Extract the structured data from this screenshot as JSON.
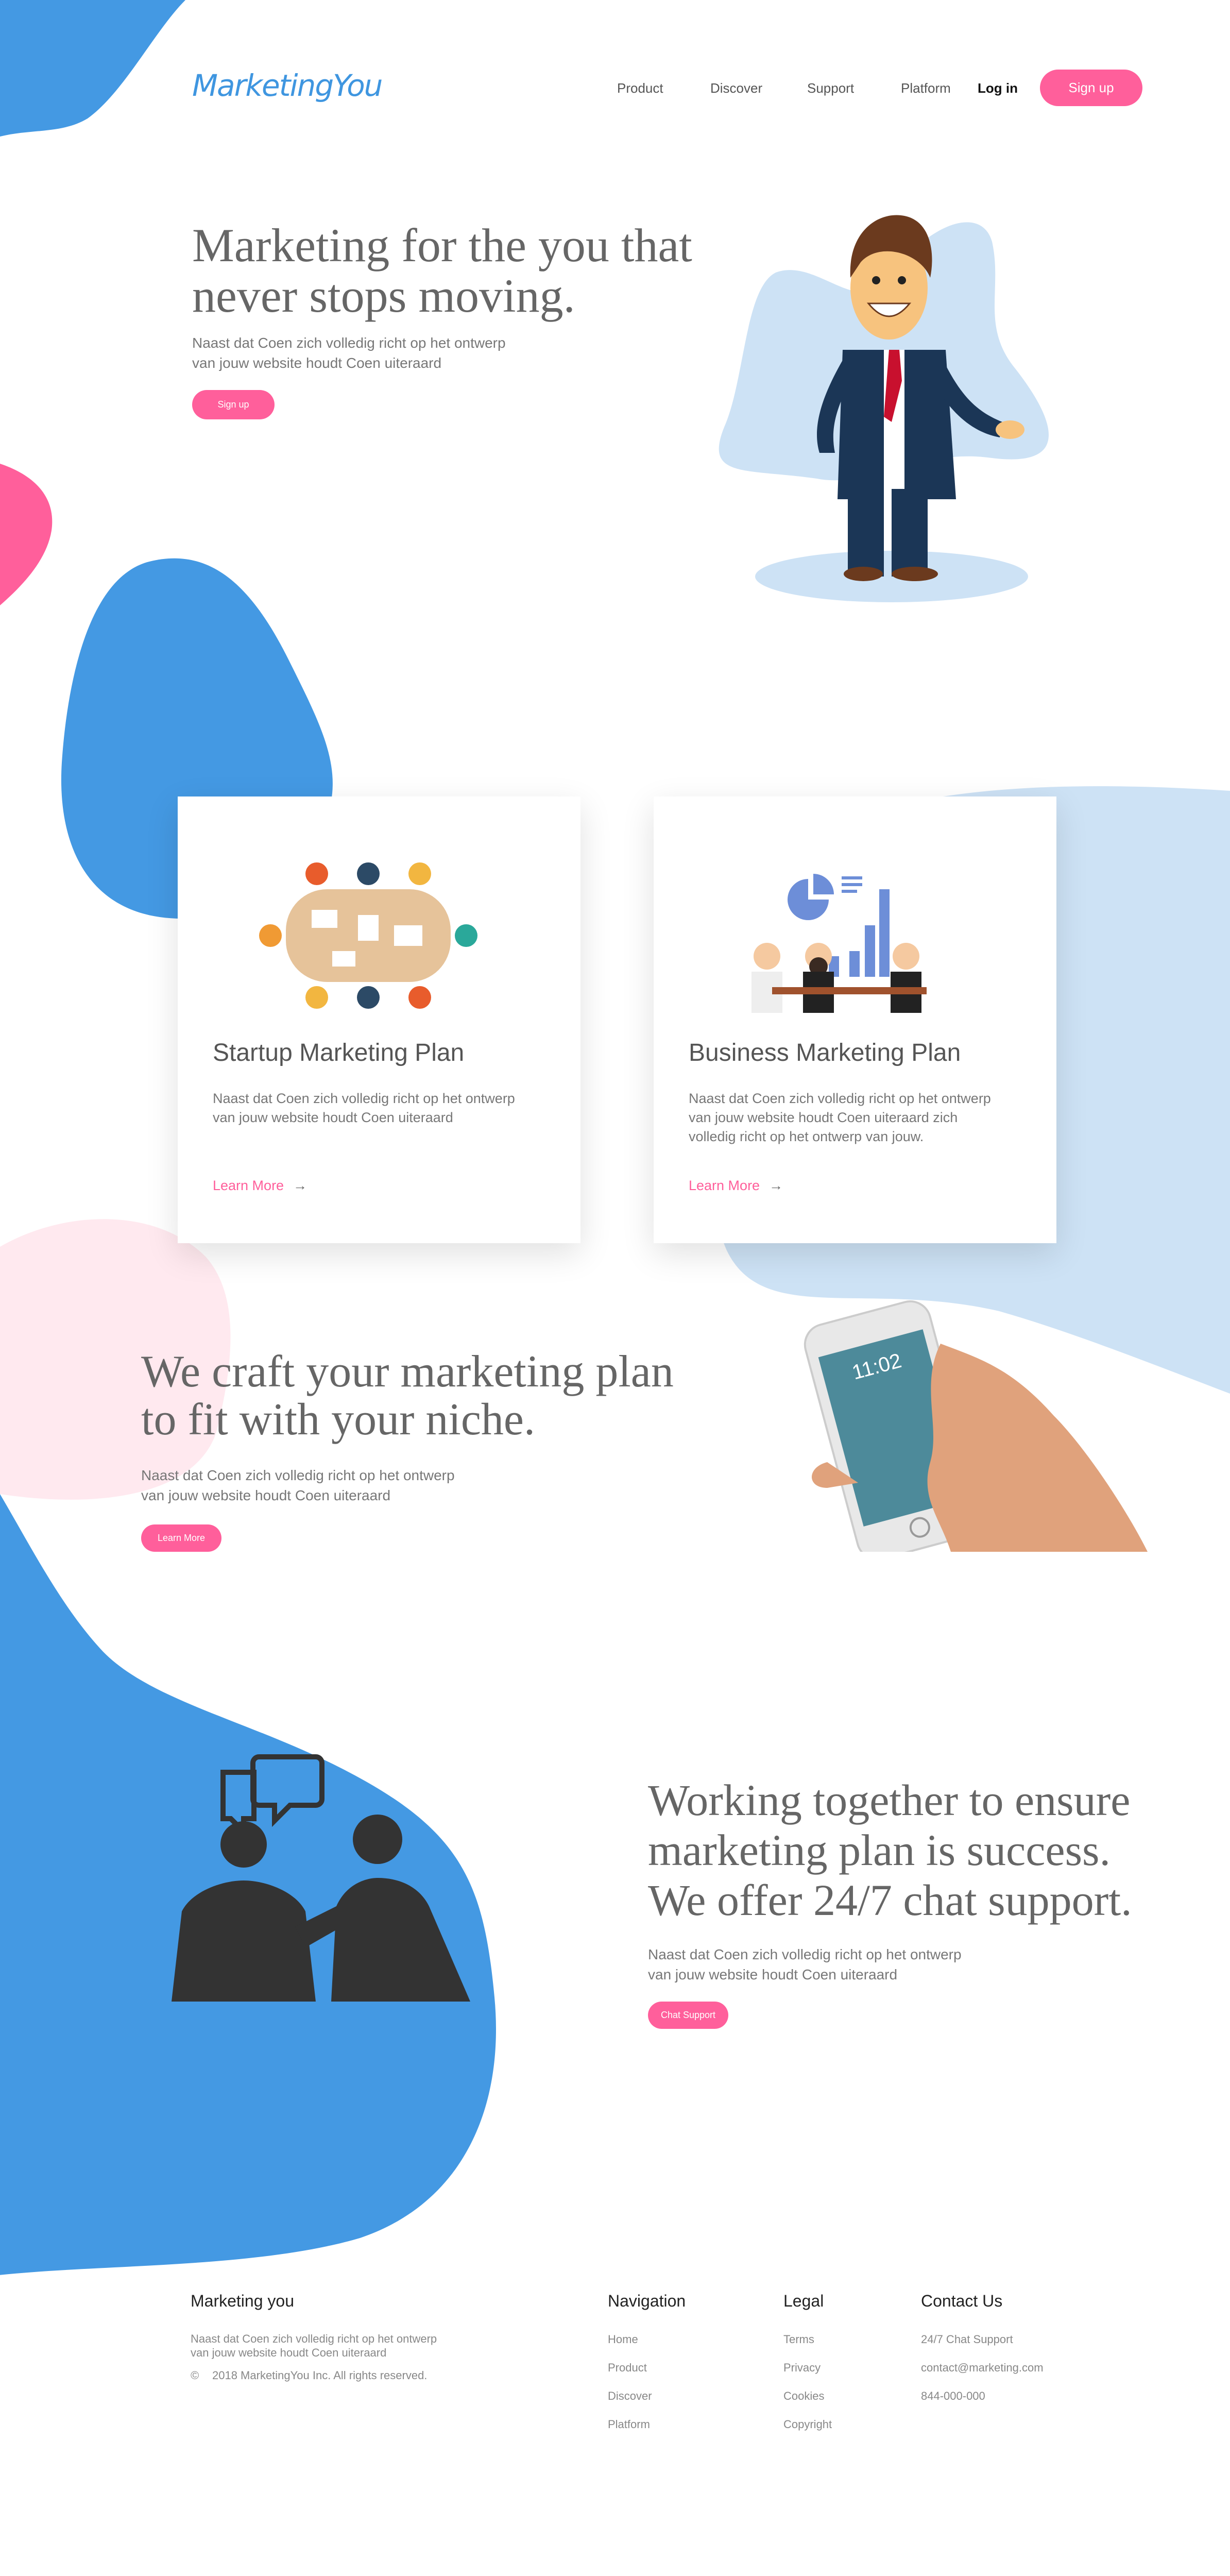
{
  "header": {
    "logo": "MarketingYou",
    "nav": [
      "Product",
      "Discover",
      "Support",
      "Platform"
    ],
    "login": "Log in",
    "signup": "Sign up"
  },
  "hero": {
    "title_line1": "Marketing for the you that",
    "title_line2": "never stops moving.",
    "desc_line1": "Naast dat Coen zich volledig richt op het ontwerp",
    "desc_line2": "van jouw website houdt Coen uiteraard",
    "button": "Sign up"
  },
  "cards": [
    {
      "title": "Startup Marketing Plan",
      "desc": "Naast dat Coen zich volledig richt op het ontwerp van jouw website houdt Coen uiteraard",
      "link": "Learn More"
    },
    {
      "title": "Business Marketing Plan",
      "desc": "Naast dat Coen zich volledig richt op het ontwerp van jouw website houdt Coen uiteraard zich volledig richt op het ontwerp van jouw.",
      "link": "Learn More"
    }
  ],
  "craft": {
    "title_line1": "We craft your marketing plan",
    "title_line2": "to fit with your niche.",
    "desc_line1": "Naast dat Coen zich volledig richt op het ontwerp",
    "desc_line2": "van jouw website houdt Coen uiteraard",
    "button": "Learn More",
    "phone_time": "11:02"
  },
  "support": {
    "title_line1": "Working together to ensure",
    "title_line2": "marketing plan is success.",
    "title_line3": "We offer 24/7 chat support.",
    "desc_line1": "Naast dat Coen zich volledig richt op het ontwerp",
    "desc_line2": "van jouw website houdt Coen uiteraard",
    "button": "Chat Support"
  },
  "footer": {
    "brand": "Marketing you",
    "desc_line1": "Naast dat Coen zich volledig richt op het ontwerp",
    "desc_line2": "van jouw website houdt Coen uiteraard",
    "copyright": "2018 MarketingYou Inc. All rights reserved.",
    "navigation": {
      "title": "Navigation",
      "items": [
        "Home",
        "Product",
        "Discover",
        "Platform"
      ]
    },
    "legal": {
      "title": "Legal",
      "items": [
        "Terms",
        "Privacy",
        "Cookies",
        "Copyright"
      ]
    },
    "contact": {
      "title": "Contact Us",
      "items": [
        "24/7 Chat Support",
        "contact@marketing.com",
        "844-000-000"
      ]
    }
  },
  "colors": {
    "blue": "#4499e3",
    "light_blue": "#cde2f5",
    "pink": "#ff5f9b",
    "light_pink": "#ffe9ef"
  }
}
